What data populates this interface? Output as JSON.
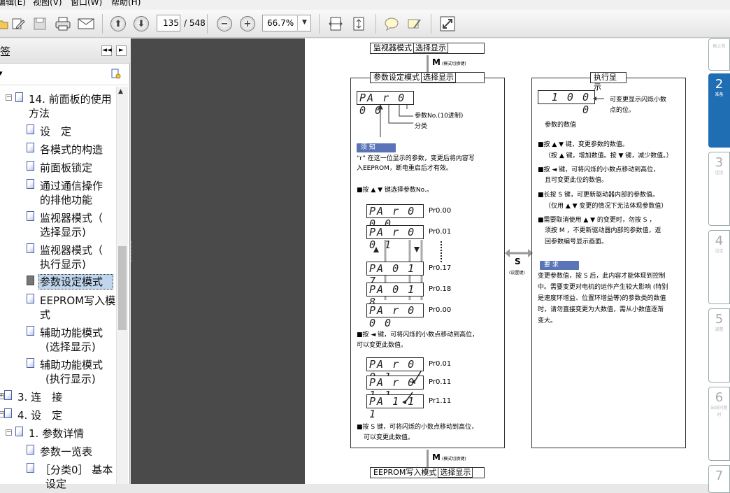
{
  "menu": {
    "items": [
      "编辑(E)",
      "视图(V)",
      "窗口(W)",
      "帮助(H)"
    ]
  },
  "toolbar": {
    "page_current": "135",
    "page_total": "/ 548",
    "zoom": "66.7%"
  },
  "sidebar": {
    "title": "签",
    "items": [
      {
        "label1": "14. 前面板的使用",
        "label2": "方法"
      },
      {
        "label1": "设　定"
      },
      {
        "label1": "各模式的构造"
      },
      {
        "label1": "前面板锁定"
      },
      {
        "label1": "通过通信操作",
        "label2": "的排他功能"
      },
      {
        "label1": "监视器模式（",
        "label2": "选择显示)"
      },
      {
        "label1": "监视器模式（",
        "label2": "执行显示)"
      },
      {
        "label1": "参数设定模式"
      },
      {
        "label1": "EEPROM写入模",
        "label2": "式"
      },
      {
        "label1": "辅助功能模式",
        "label2": "(选择显示)"
      },
      {
        "label1": "辅助功能模式",
        "label2": "(执行显示)"
      },
      {
        "label1": "3. 连　接"
      },
      {
        "label1": "4. 设　定"
      },
      {
        "label1": "1. 参数详情"
      },
      {
        "label1": "参数一览表"
      },
      {
        "label1": "［分类0］ 基本",
        "label2": "设定"
      }
    ]
  },
  "doc": {
    "top_title": "监视器模式",
    "top_title_box": "选择显示",
    "m_key": "M",
    "m_key_note": "(模式切换键)",
    "param_title": "参数设定模式",
    "param_title_box": "选择显示",
    "exec_title": "执行显示",
    "lcd_main": "PA r 0 0 0",
    "label_param_no": "参数No.(10进制)",
    "label_class": "分类",
    "note_label": "须 知",
    "note_text1": "“r” 在这一位显示的参数，变更后将内容写",
    "note_text2": "入EEPROM，断电重启后才有效。",
    "select_line": "■按 ▲ ▼ 键选择参数No.。",
    "seq": [
      {
        "lcd": "PA r 0 0 0",
        "label": "Pr0.00"
      },
      {
        "lcd": "PA r 0 0 1",
        "label": "Pr0.01"
      },
      {
        "lcd": "PA  0 1 7",
        "label": "Pr0.17"
      },
      {
        "lcd": "PA  0 1 8",
        "label": "Pr0.18"
      },
      {
        "lcd": "PA r 0 0 0",
        "label": "Pr0.00"
      }
    ],
    "shift_line1": "■按 ◄ 键，可将闪烁的小数点移动到高位，",
    "shift_line2": "可以变更此数值。",
    "seq2": [
      {
        "lcd": "PA r 0 0 1",
        "label": "Pr0.01"
      },
      {
        "lcd": "PA r 0 1 1",
        "label": "Pr0.11"
      },
      {
        "lcd": "PA  1 1 1",
        "label": "Pr1.11"
      }
    ],
    "s_line1": "■按 S 键，可将闪烁的小数点移动到高位，",
    "s_line2": "可以变更此数值。",
    "s_key": "S",
    "s_key_note": "(设置键)",
    "exec_lcd": "1 0 0 0",
    "exec_label1": "可变更显示闪烁小数",
    "exec_label2": "点的位。",
    "exec_value_label": "参数的数值",
    "exec_lines": [
      "■按 ▲ ▼ 键，变更参数的数值。",
      "（按 ▲ 键，增加数值。按 ▼ 键，减少数值。）",
      "■按 ◄ 键，可将闪烁的小数点移动到高位，",
      "且可变更此位的数值。",
      "■长按 S 键，可更新驱动器内部的参数值。",
      "（仅用 ▲ ▼ 变更的情况下无法体现参数值）",
      "■需要取消使用 ▲ ▼ 的变更时，勿按 S ，",
      "须按 M ，不更新驱动器内部的参数值，返",
      "回参数编号显示画面。"
    ],
    "req_label": "要 求",
    "req_lines": [
      "变更参数值，按 S 后，此内容才能体现到控制",
      "中。需要变更对电机的运作产生较大影响 (特别",
      "是速度环增益、位置环增益等)的参数类的数值",
      "时，请勿直接变更为大数值，需从小数值逐渐",
      "变大。"
    ],
    "bottom_key": "M",
    "bottom_key_note": "(模式切换键)",
    "bottom_title": "EEPROM写入模式",
    "bottom_title_box": "选择显示"
  },
  "tabs": [
    {
      "num": "",
      "text": "概之前"
    },
    {
      "num": "2",
      "text": "准备"
    },
    {
      "num": "3",
      "text": "连接"
    },
    {
      "num": "4",
      "text": "设定"
    },
    {
      "num": "5",
      "text": "调整"
    },
    {
      "num": "6",
      "text": "出现问题时"
    },
    {
      "num": "7",
      "text": ""
    }
  ]
}
